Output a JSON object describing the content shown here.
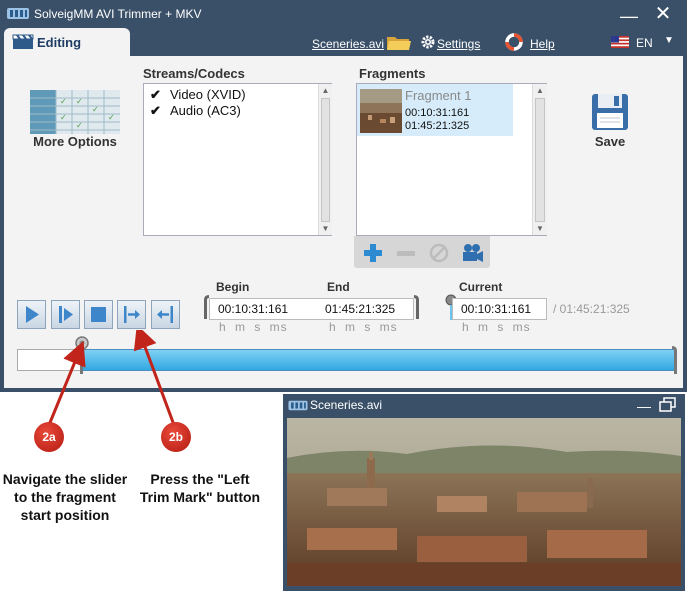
{
  "window": {
    "title": "SolveigMM AVI Trimmer  + MKV",
    "minimize_symbol": "—",
    "close_symbol": "✕"
  },
  "toolbar": {
    "tab_label": "Editing",
    "file_name": "Sceneries.avi",
    "settings_label": "Settings",
    "help_label": "Help",
    "language": "EN"
  },
  "left": {
    "more_options_label": "More Options"
  },
  "streams": {
    "title": "Streams/Codecs",
    "items": [
      {
        "label": "Video (XVID)",
        "checked": true
      },
      {
        "label": "Audio (AC3)",
        "checked": true
      }
    ]
  },
  "fragments": {
    "title": "Fragments",
    "items": [
      {
        "name": "Fragment 1",
        "start": "00:10:31:161",
        "end": "01:45:21:325"
      }
    ]
  },
  "save_label": "Save",
  "times": {
    "begin_label": "Begin",
    "end_label": "End",
    "current_label": "Current",
    "begin_value": "00:10:31:161",
    "end_value": "01:45:21:325",
    "current_value": "00:10:31:161",
    "total_value": "/ 01:45:21:325",
    "units": "h m s ms"
  },
  "slider": {
    "position_fraction": 0.1
  },
  "annotations": {
    "a_badge": "2a",
    "b_badge": "2b",
    "a_text": "Navigate the slider to the fragment start position",
    "b_text": "Press the \"Left Trim Mark\" button"
  },
  "video_window": {
    "title": "Sceneries.avi"
  },
  "colors": {
    "window_chrome": "#3a5068",
    "client_bg": "#f3f3f3",
    "slider_fill": "#33a8e2",
    "fragment_selected": "#d6ecfa",
    "annotation_red": "#c0241a"
  },
  "icons": {
    "app": "film-strip-icon",
    "tab": "clapperboard-icon",
    "folder": "folder-icon",
    "settings": "gear-icon",
    "help": "lifebuoy-icon",
    "language": "us-flag-icon",
    "save": "floppy-disk-icon",
    "add_fragment": "plus-icon",
    "remove_fragment": "minus-icon",
    "clear_fragment": "no-sign-icon",
    "preview_fragment": "camera-icon"
  }
}
